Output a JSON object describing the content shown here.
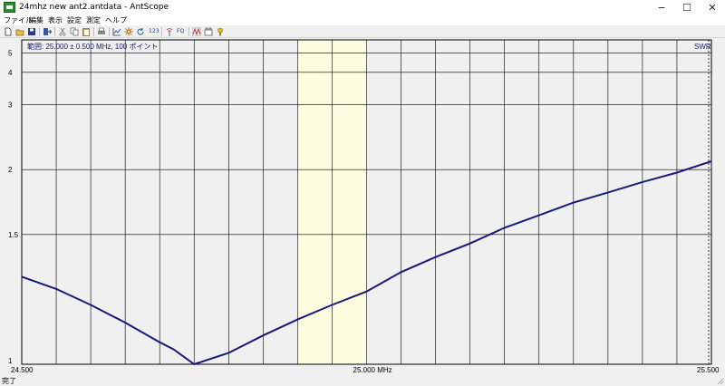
{
  "window": {
    "title": "24mhz new ant2.antdata - AntScope",
    "minimize": "−",
    "maximize": "☐",
    "close": "✕"
  },
  "menu": [
    "ファイル",
    "編集",
    "表示",
    "設定",
    "測定",
    "ヘルプ"
  ],
  "toolbar": {
    "icons": [
      "new-file-icon",
      "open-folder-icon",
      "save-icon",
      "export-icon",
      "cut-icon",
      "copy-icon",
      "paste-icon",
      "print-icon",
      "chart-icon",
      "settings-icon",
      "refresh-icon",
      "numbers-icon",
      "antenna-icon",
      "fq-icon",
      "sweep-icon",
      "calibrate-icon",
      "help-icon"
    ],
    "numbers_label": "123",
    "fq_label": "FQ"
  },
  "plot": {
    "range_label": "範囲: 25.000 ± 0.500 MHz, 100 ポイント",
    "mode_label": "SWR",
    "x_start_label": "24.500",
    "x_center_label": "25.000 MHz",
    "x_end_label": "25.500",
    "line_color": "#1a1a7a",
    "band_color": "#fffde0",
    "bg_color": "#f0f0f0"
  },
  "chart_data": {
    "type": "line",
    "title": "",
    "xlabel": "",
    "ylabel": "",
    "series_name": "SWR",
    "xlim": [
      24.5,
      25.5
    ],
    "ylim": [
      1,
      6
    ],
    "y_scale": "reciprocal",
    "y_ticks": [
      1,
      1.5,
      2,
      3,
      4,
      5
    ],
    "y_tick_labels": [
      "1",
      "1.5",
      "2",
      "3",
      "4",
      "5"
    ],
    "highlight_band": [
      24.9,
      25.0
    ],
    "x": [
      24.5,
      24.55,
      24.6,
      24.65,
      24.7,
      24.72,
      24.75,
      24.8,
      24.85,
      24.9,
      24.95,
      25.0,
      25.05,
      25.1,
      25.15,
      25.2,
      25.25,
      25.3,
      25.35,
      25.4,
      25.45,
      25.5
    ],
    "y": [
      1.29,
      1.24,
      1.18,
      1.12,
      1.06,
      1.04,
      1.0,
      1.03,
      1.08,
      1.13,
      1.18,
      1.23,
      1.31,
      1.38,
      1.45,
      1.54,
      1.62,
      1.71,
      1.79,
      1.88,
      1.97,
      2.09
    ]
  },
  "status": {
    "text": "完了"
  }
}
